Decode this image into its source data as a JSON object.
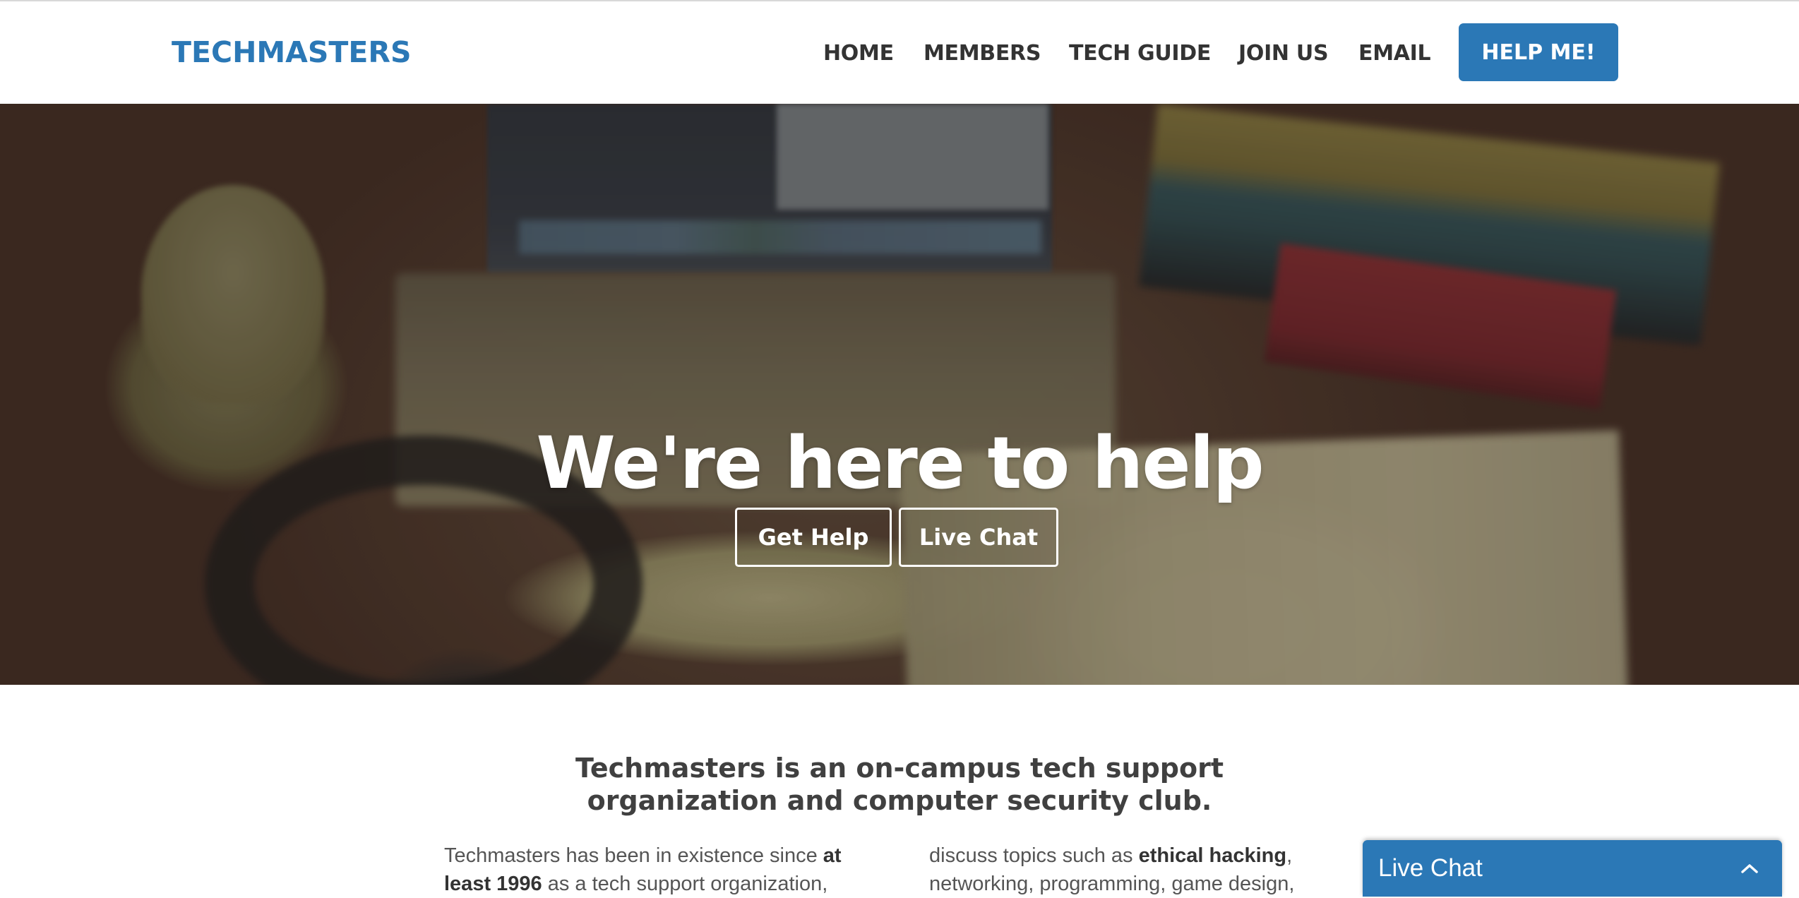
{
  "header": {
    "logo": "TECHMASTERS",
    "nav": [
      {
        "label": "HOME"
      },
      {
        "label": "MEMBERS"
      },
      {
        "label": "TECH GUIDE"
      },
      {
        "label": "JOIN US"
      },
      {
        "label": "EMAIL"
      }
    ],
    "help_button": "HELP ME!"
  },
  "hero": {
    "title": "We're here to help",
    "buttons": {
      "get_help": "Get Help",
      "live_chat": "Live Chat"
    }
  },
  "intro": {
    "title_line1": "Techmasters is an on-campus tech support",
    "title_line2": "organization and computer security club.",
    "col_left": {
      "t1": "Techmasters has been in existence since ",
      "b1": "at least 1996",
      "t2": " as a tech support organization,"
    },
    "col_right": {
      "t1": "discuss topics such as ",
      "b1": "ethical hacking",
      "t2": ", networking, programming, game design,"
    }
  },
  "live_chat_widget": {
    "label": "Live Chat",
    "icon": "chevron-up-icon"
  },
  "colors": {
    "brand_blue": "#2b78b6",
    "nav_text": "#333333",
    "heading_text": "#404040"
  }
}
